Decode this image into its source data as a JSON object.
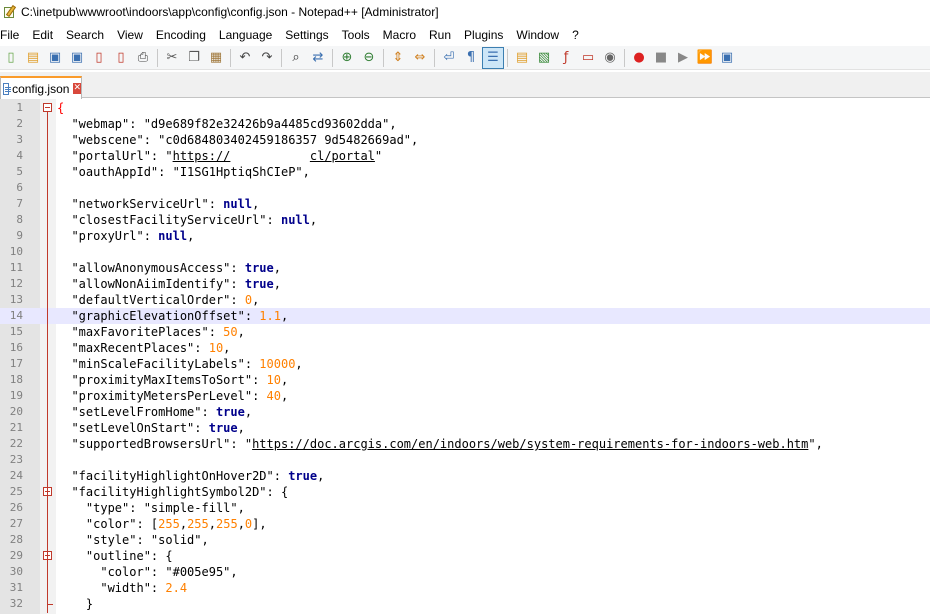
{
  "window": {
    "title": "C:\\inetpub\\wwwroot\\indoors\\app\\config\\config.json - Notepad++ [Administrator]"
  },
  "menu": [
    "File",
    "Edit",
    "Search",
    "View",
    "Encoding",
    "Language",
    "Settings",
    "Tools",
    "Macro",
    "Run",
    "Plugins",
    "Window",
    "?"
  ],
  "toolbar": {
    "buttons": [
      "new-file-icon",
      "open-file-icon",
      "save-icon",
      "save-all-icon",
      "close-icon",
      "close-all-icon",
      "print-icon",
      "cut-icon",
      "copy-icon",
      "paste-icon",
      "undo-icon",
      "redo-icon",
      "find-icon",
      "replace-icon",
      "zoom-in-icon",
      "zoom-out-icon",
      "sync-vertical-icon",
      "sync-horizontal-icon",
      "word-wrap-icon",
      "show-all-chars-icon",
      "indent-guide-icon",
      "user-language-icon",
      "doc-map-icon",
      "function-list-icon",
      "folder-workspace-icon",
      "monitoring-icon",
      "record-macro-icon",
      "stop-record-icon",
      "play-macro-icon",
      "run-macro-multiple-icon",
      "save-macro-icon"
    ]
  },
  "tab": {
    "label": "config.json"
  },
  "colors": {
    "keyword": "#00008b",
    "number": "#ff8000",
    "string": "#808080",
    "current_line": "#e8e8ff",
    "fold": "#c0392b",
    "tab_accent": "#fa9b2b"
  },
  "editor": {
    "current_line": 14,
    "lines": [
      [
        {
          "t": "{",
          "c": "brace-hl"
        }
      ],
      [
        {
          "t": "  \"webmap\": ",
          "c": "k"
        },
        {
          "t": "\"d9e689f82e32426b9a4485cd93602dda\"",
          "c": "k"
        },
        {
          "t": ",",
          "c": "k"
        }
      ],
      [
        {
          "t": "  \"webscene\": ",
          "c": "k"
        },
        {
          "t": "\"c0d684803402459186357 9d5482669ad\"",
          "c": "k"
        },
        {
          "t": ",",
          "c": "k"
        }
      ],
      [
        {
          "t": "  \"portalUrl\": \"",
          "c": "k"
        },
        {
          "t": "https://",
          "c": "url"
        },
        {
          "t": "           ",
          "c": "k"
        },
        {
          "t": "cl/portal",
          "c": "url"
        },
        {
          "t": "\"",
          "c": "k"
        }
      ],
      [
        {
          "t": "  \"oauthAppId\": \"I1SG1HptiqShCIeP\",",
          "c": "k"
        }
      ],
      [],
      [
        {
          "t": "  \"networkServiceUrl\": ",
          "c": "k"
        },
        {
          "t": "null",
          "c": "kw"
        },
        {
          "t": ",",
          "c": "k"
        }
      ],
      [
        {
          "t": "  \"closestFacilityServiceUrl\": ",
          "c": "k"
        },
        {
          "t": "null",
          "c": "kw"
        },
        {
          "t": ",",
          "c": "k"
        }
      ],
      [
        {
          "t": "  \"proxyUrl\": ",
          "c": "k"
        },
        {
          "t": "null",
          "c": "kw"
        },
        {
          "t": ",",
          "c": "k"
        }
      ],
      [],
      [
        {
          "t": "  \"allowAnonymousAccess\": ",
          "c": "k"
        },
        {
          "t": "true",
          "c": "kw"
        },
        {
          "t": ",",
          "c": "k"
        }
      ],
      [
        {
          "t": "  \"allowNonAiimIdentify\": ",
          "c": "k"
        },
        {
          "t": "true",
          "c": "kw"
        },
        {
          "t": ",",
          "c": "k"
        }
      ],
      [
        {
          "t": "  \"defaultVerticalOrder\": ",
          "c": "k"
        },
        {
          "t": "0",
          "c": "num"
        },
        {
          "t": ",",
          "c": "k"
        }
      ],
      [
        {
          "t": "  \"graphicElevationOffset\": ",
          "c": "k"
        },
        {
          "t": "1.1",
          "c": "num"
        },
        {
          "t": ",",
          "c": "k"
        }
      ],
      [
        {
          "t": "  \"maxFavoritePlaces\": ",
          "c": "k"
        },
        {
          "t": "50",
          "c": "num"
        },
        {
          "t": ",",
          "c": "k"
        }
      ],
      [
        {
          "t": "  \"maxRecentPlaces\": ",
          "c": "k"
        },
        {
          "t": "10",
          "c": "num"
        },
        {
          "t": ",",
          "c": "k"
        }
      ],
      [
        {
          "t": "  \"minScaleFacilityLabels\": ",
          "c": "k"
        },
        {
          "t": "10000",
          "c": "num"
        },
        {
          "t": ",",
          "c": "k"
        }
      ],
      [
        {
          "t": "  \"proximityMaxItemsToSort\": ",
          "c": "k"
        },
        {
          "t": "10",
          "c": "num"
        },
        {
          "t": ",",
          "c": "k"
        }
      ],
      [
        {
          "t": "  \"proximityMetersPerLevel\": ",
          "c": "k"
        },
        {
          "t": "40",
          "c": "num"
        },
        {
          "t": ",",
          "c": "k"
        }
      ],
      [
        {
          "t": "  \"setLevelFromHome\": ",
          "c": "k"
        },
        {
          "t": "true",
          "c": "kw"
        },
        {
          "t": ",",
          "c": "k"
        }
      ],
      [
        {
          "t": "  \"setLevelOnStart\": ",
          "c": "k"
        },
        {
          "t": "true",
          "c": "kw"
        },
        {
          "t": ",",
          "c": "k"
        }
      ],
      [
        {
          "t": "  \"supportedBrowsersUrl\": \"",
          "c": "k"
        },
        {
          "t": "https://doc.arcgis.com/en/indoors/web/system-requirements-for-indoors-web.htm",
          "c": "url"
        },
        {
          "t": "\",",
          "c": "k"
        }
      ],
      [],
      [
        {
          "t": "  \"facilityHighlightOnHover2D\": ",
          "c": "k"
        },
        {
          "t": "true",
          "c": "kw"
        },
        {
          "t": ",",
          "c": "k"
        }
      ],
      [
        {
          "t": "  \"facilityHighlightSymbol2D\": {",
          "c": "k"
        }
      ],
      [
        {
          "t": "    \"type\": \"simple-fill\",",
          "c": "k"
        }
      ],
      [
        {
          "t": "    \"color\": [",
          "c": "k"
        },
        {
          "t": "255",
          "c": "num"
        },
        {
          "t": ",",
          "c": "k"
        },
        {
          "t": "255",
          "c": "num"
        },
        {
          "t": ",",
          "c": "k"
        },
        {
          "t": "255",
          "c": "num"
        },
        {
          "t": ",",
          "c": "k"
        },
        {
          "t": "0",
          "c": "num"
        },
        {
          "t": "],",
          "c": "k"
        }
      ],
      [
        {
          "t": "    \"style\": \"solid\",",
          "c": "k"
        }
      ],
      [
        {
          "t": "    \"outline\": {",
          "c": "k"
        }
      ],
      [
        {
          "t": "      \"color\": \"#005e95\",",
          "c": "k"
        }
      ],
      [
        {
          "t": "      \"width\": ",
          "c": "k"
        },
        {
          "t": "2.4",
          "c": "num"
        }
      ],
      [
        {
          "t": "    }",
          "c": "k"
        }
      ]
    ],
    "folds": [
      1,
      25,
      29
    ]
  }
}
